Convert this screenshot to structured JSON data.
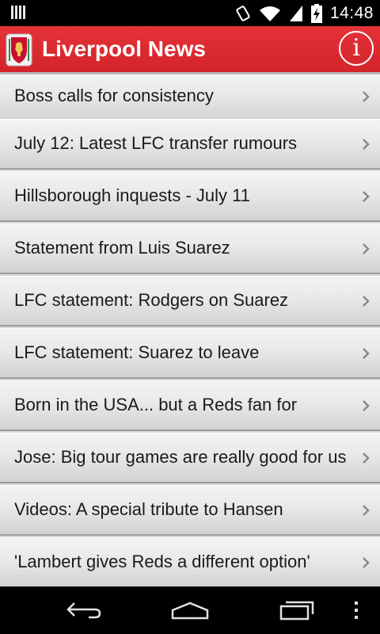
{
  "status_bar": {
    "time": "14:48",
    "icons": [
      "signal-bars-icon",
      "vibrate-icon",
      "wifi-icon",
      "cellular-icon",
      "battery-charging-icon"
    ]
  },
  "app": {
    "title": "Liverpool News",
    "logo_icon": "liverpool-crest-icon",
    "info_icon": "info-icon",
    "info_label": "i",
    "accent_color": "#dd2b31"
  },
  "news": {
    "items": [
      {
        "title": "Boss calls for consistency"
      },
      {
        "title": "July 12: Latest LFC transfer rumours"
      },
      {
        "title": "Hillsborough inquests - July 11"
      },
      {
        "title": "Statement from Luis Suarez"
      },
      {
        "title": "LFC statement: Rodgers on Suarez"
      },
      {
        "title": "LFC statement: Suarez to leave"
      },
      {
        "title": "Born in the USA... but a Reds fan for"
      },
      {
        "title": "Jose: Big tour games are really good for us"
      },
      {
        "title": "Videos: A special tribute to Hansen"
      },
      {
        "title": "'Lambert gives Reds a different option'"
      }
    ]
  },
  "nav_bar": {
    "buttons": [
      "back-icon",
      "home-icon",
      "recents-icon",
      "menu-icon"
    ]
  }
}
